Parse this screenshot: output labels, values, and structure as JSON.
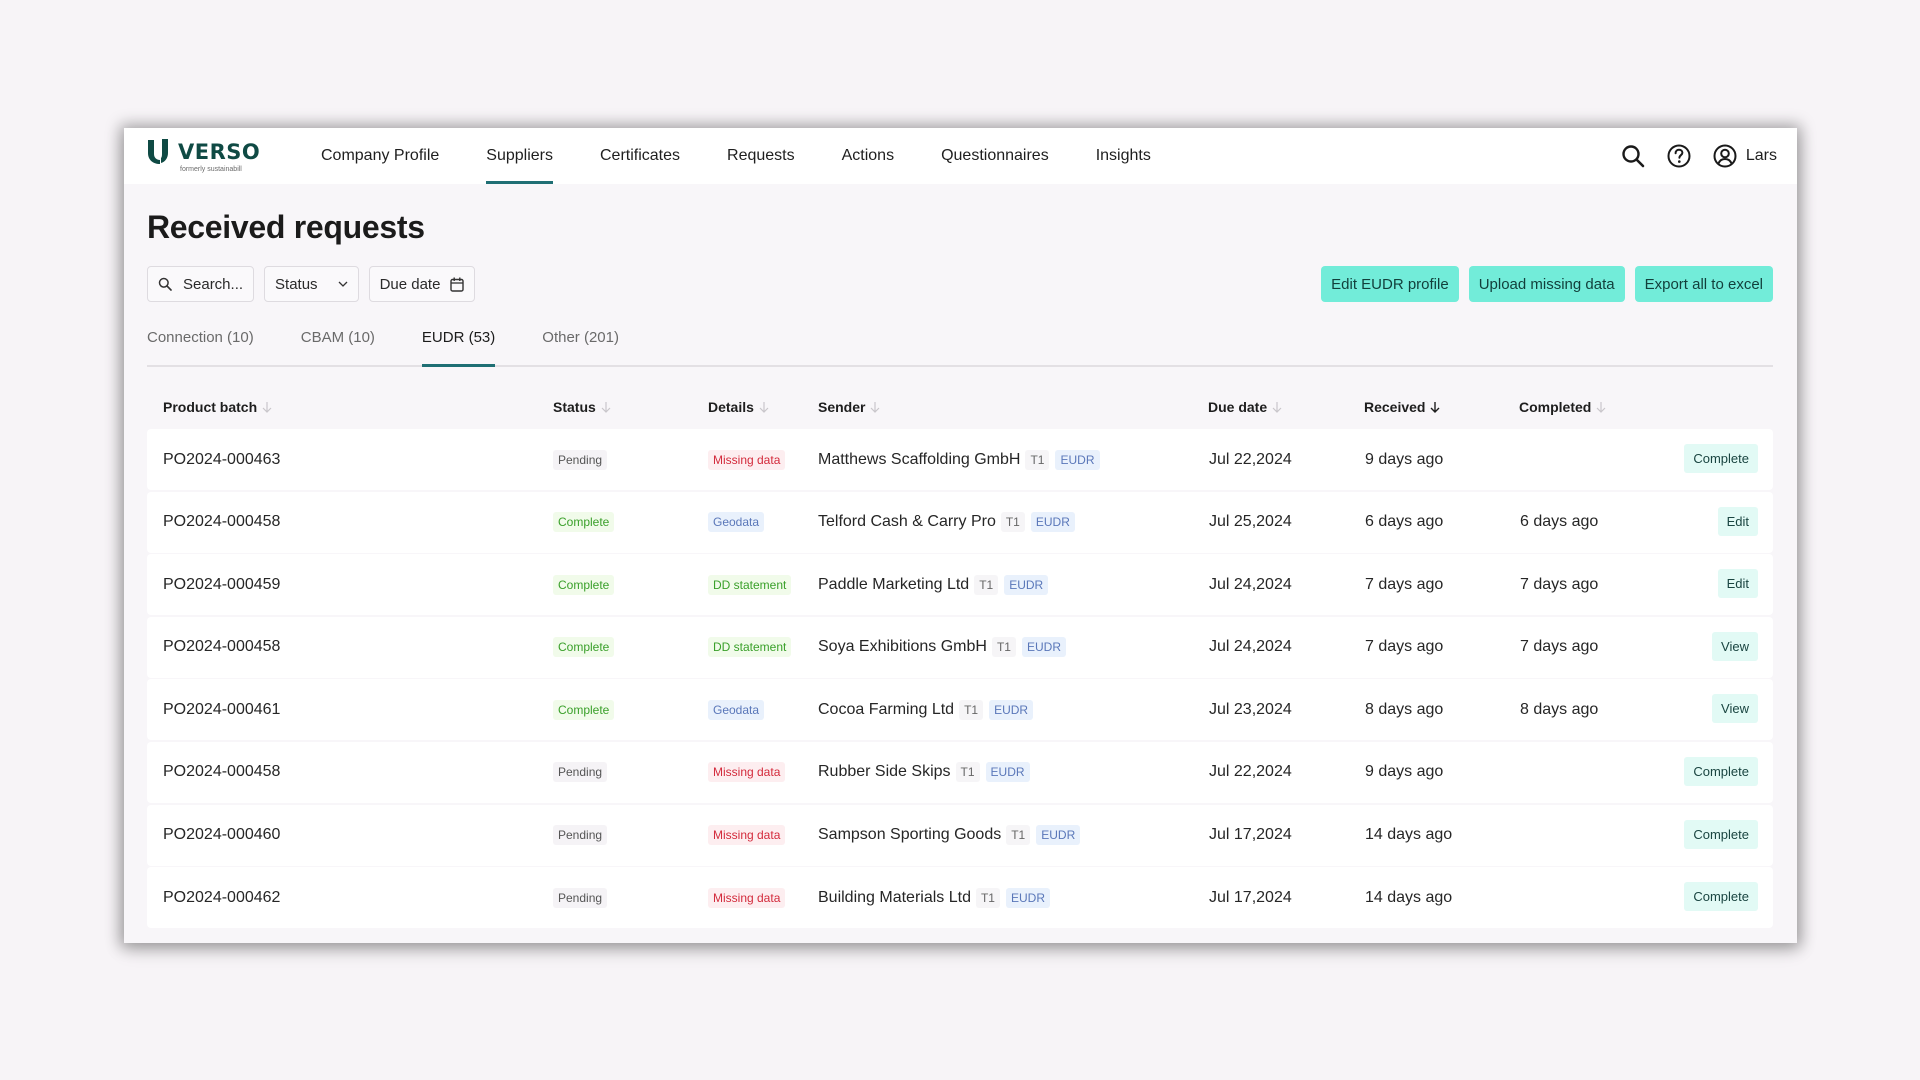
{
  "brand": {
    "name": "VERSO",
    "tagline": "formerly sustainabill",
    "color": "#0f4a44"
  },
  "nav": {
    "items": [
      {
        "label": "Company Profile",
        "active": false
      },
      {
        "label": "Suppliers",
        "active": true
      },
      {
        "label": "Certificates",
        "active": false
      },
      {
        "label": "Requests",
        "active": false
      },
      {
        "label": "Actions",
        "active": false
      },
      {
        "label": "Questionnaires",
        "active": false
      },
      {
        "label": "Insights",
        "active": false
      }
    ],
    "icons": [
      "search-icon",
      "help-icon",
      "user-icon"
    ],
    "user_name": "Lars"
  },
  "page": {
    "title": "Received requests"
  },
  "filters": {
    "search_placeholder": "Search...",
    "status_label": "Status",
    "due_date_label": "Due date"
  },
  "actions": {
    "edit_profile": "Edit EUDR profile",
    "upload_missing": "Upload missing data",
    "export_all": "Export all to excel",
    "accent_color": "#72ecd9"
  },
  "tabs": [
    {
      "label": "Connection (10)",
      "active": false
    },
    {
      "label": "CBAM (10)",
      "active": false
    },
    {
      "label": "EUDR (53)",
      "active": true
    },
    {
      "label": "Other (201)",
      "active": false
    }
  ],
  "table": {
    "columns": {
      "product_batch": "Product batch",
      "status": "Status",
      "details": "Details",
      "sender": "Sender",
      "due_date": "Due date",
      "received": "Received",
      "completed": "Completed"
    },
    "sorted_by": "Received",
    "rows": [
      {
        "batch": "PO2024-000463",
        "status": "Pending",
        "details": "Missing data",
        "sender": "Matthews Scaffolding GmbH",
        "tier": "T1",
        "tag": "EUDR",
        "due": "Jul 22,2024",
        "received": "9 days ago",
        "completed": "",
        "action": "Complete"
      },
      {
        "batch": "PO2024-000458",
        "status": "Complete",
        "details": "Geodata",
        "sender": "Telford Cash & Carry Pro",
        "tier": "T1",
        "tag": "EUDR",
        "due": "Jul 25,2024",
        "received": "6 days ago",
        "completed": "6 days ago",
        "action": "Edit"
      },
      {
        "batch": "PO2024-000459",
        "status": "Complete",
        "details": "DD statement",
        "sender": "Paddle Marketing Ltd",
        "tier": "T1",
        "tag": "EUDR",
        "due": "Jul 24,2024",
        "received": "7 days ago",
        "completed": "7 days ago",
        "action": "Edit"
      },
      {
        "batch": "PO2024-000458",
        "status": "Complete",
        "details": "DD statement",
        "sender": "Soya Exhibitions GmbH",
        "tier": "T1",
        "tag": "EUDR",
        "due": "Jul 24,2024",
        "received": "7 days ago",
        "completed": "7 days ago",
        "action": "View"
      },
      {
        "batch": "PO2024-000461",
        "status": "Complete",
        "details": "Geodata",
        "sender": "Cocoa Farming Ltd",
        "tier": "T1",
        "tag": "EUDR",
        "due": "Jul 23,2024",
        "received": "8 days ago",
        "completed": "8 days ago",
        "action": "View"
      },
      {
        "batch": "PO2024-000458",
        "status": "Pending",
        "details": "Missing data",
        "sender": "Rubber Side Skips",
        "tier": "T1",
        "tag": "EUDR",
        "due": "Jul 22,2024",
        "received": "9 days ago",
        "completed": "",
        "action": "Complete"
      },
      {
        "batch": "PO2024-000460",
        "status": "Pending",
        "details": "Missing data",
        "sender": "Sampson Sporting Goods",
        "tier": "T1",
        "tag": "EUDR",
        "due": "Jul 17,2024",
        "received": "14 days ago",
        "completed": "",
        "action": "Complete"
      },
      {
        "batch": "PO2024-000462",
        "status": "Pending",
        "details": "Missing data",
        "sender": "Building Materials Ltd",
        "tier": "T1",
        "tag": "EUDR",
        "due": "Jul 17,2024",
        "received": "14 days ago",
        "completed": "",
        "action": "Complete"
      }
    ]
  },
  "colors": {
    "pending": "#555555",
    "complete": "#3aa02a",
    "missing": "#d32a3b",
    "geodata": "#5a77b9",
    "tab_underline": "#1f6f74"
  }
}
